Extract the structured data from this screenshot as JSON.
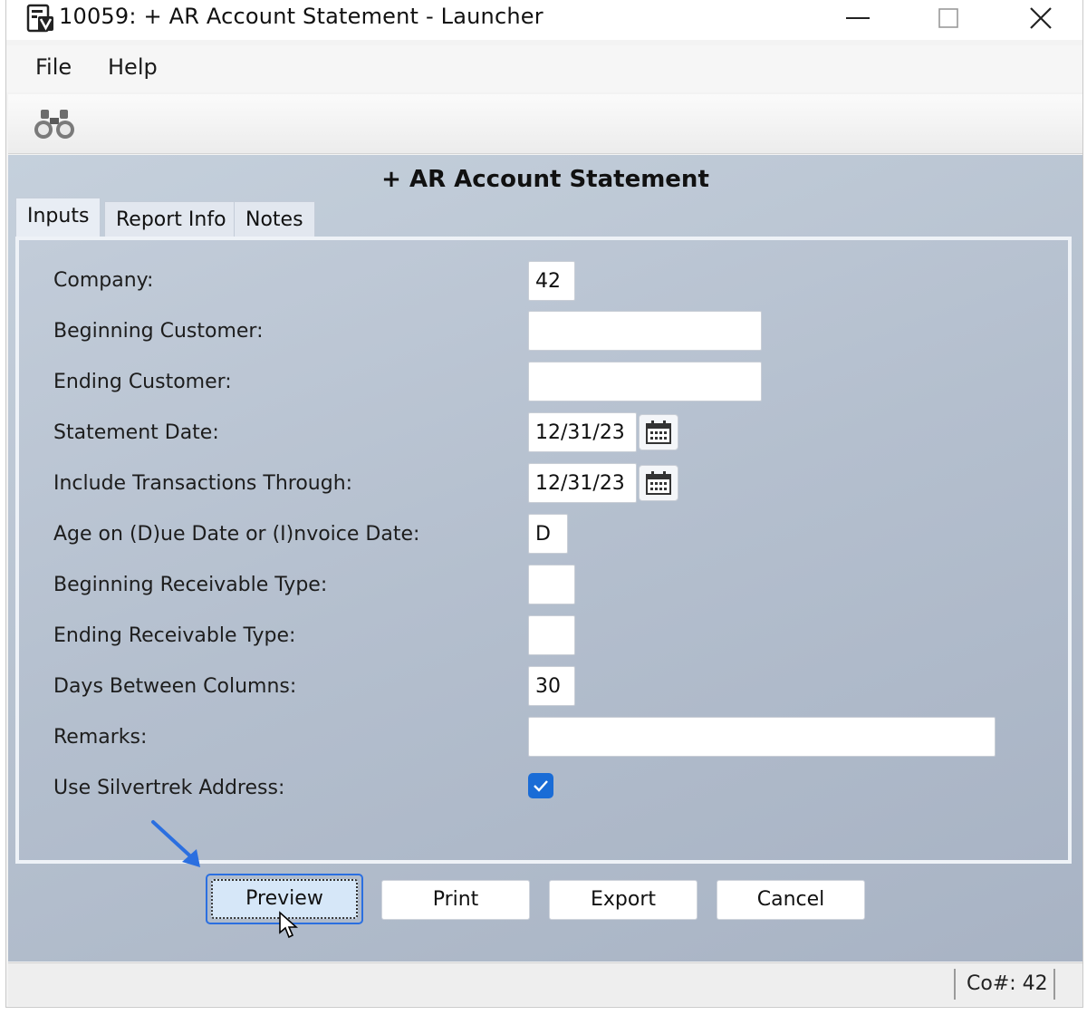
{
  "window": {
    "title": "10059: + AR Account Statement - Launcher"
  },
  "menu": {
    "file": "File",
    "help": "Help"
  },
  "toolbar": {
    "icons": [
      "binoculars-icon"
    ]
  },
  "report": {
    "title": "+ AR Account Statement"
  },
  "tabs": [
    {
      "label": "Inputs",
      "active": true
    },
    {
      "label": "Report Info",
      "active": false
    },
    {
      "label": "Notes",
      "active": false
    }
  ],
  "fields": {
    "company": {
      "label": "Company:",
      "value": "42"
    },
    "beginning_customer": {
      "label": "Beginning Customer:",
      "value": ""
    },
    "ending_customer": {
      "label": "Ending Customer:",
      "value": ""
    },
    "statement_date": {
      "label": "Statement Date:",
      "value": "12/31/23"
    },
    "include_through": {
      "label": "Include Transactions Through:",
      "value": "12/31/23"
    },
    "age_on": {
      "label": "Age on (D)ue Date or (I)nvoice Date:",
      "value": "D"
    },
    "beginning_receivable_type": {
      "label": "Beginning Receivable Type:",
      "value": ""
    },
    "ending_receivable_type": {
      "label": "Ending Receivable Type:",
      "value": ""
    },
    "days_between_columns": {
      "label": "Days Between Columns:",
      "value": "30"
    },
    "remarks": {
      "label": "Remarks:",
      "value": ""
    },
    "use_silvertrek_address": {
      "label": "Use Silvertrek Address:",
      "checked": true
    }
  },
  "buttons": {
    "preview": "Preview",
    "print": "Print",
    "export": "Export",
    "cancel": "Cancel"
  },
  "status": {
    "company": "Co#: 42"
  },
  "colors": {
    "accent": "#2b6fe0",
    "checkbox": "#1a6cd6",
    "panel": "#b7c2d0"
  }
}
